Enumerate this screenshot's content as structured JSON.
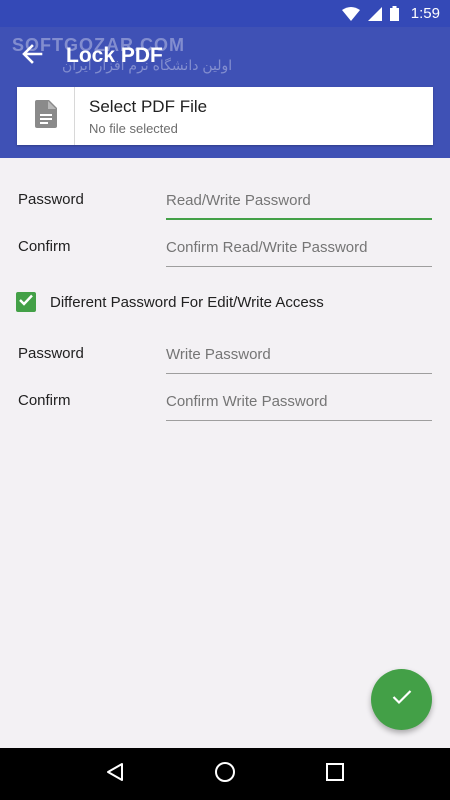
{
  "status_bar": {
    "time": "1:59",
    "icons": [
      "wifi-icon",
      "signal-icon",
      "battery-icon"
    ]
  },
  "header": {
    "title": "Lock PDF",
    "watermark": "SOFTGOZAR.COM",
    "watermark_sub": "اولین دانشگاه نرم افزار ایران",
    "color": "#3f51b5"
  },
  "file_picker": {
    "title": "Select PDF File",
    "subtitle": "No file selected",
    "icon": "document-icon"
  },
  "form": {
    "rw_password": {
      "label": "Password",
      "placeholder": "Read/Write Password",
      "value": ""
    },
    "rw_confirm": {
      "label": "Confirm",
      "placeholder": "Confirm Read/Write Password",
      "value": ""
    },
    "different_password": {
      "label": "Different Password For Edit/Write Access",
      "checked": true
    },
    "w_password": {
      "label": "Password",
      "placeholder": "Write Password",
      "value": ""
    },
    "w_confirm": {
      "label": "Confirm",
      "placeholder": "Confirm Write Password",
      "value": ""
    }
  },
  "fab": {
    "icon": "check-icon",
    "color": "#43a047"
  },
  "nav_bar": {
    "icons": [
      "back-icon",
      "home-icon",
      "recents-icon"
    ]
  }
}
